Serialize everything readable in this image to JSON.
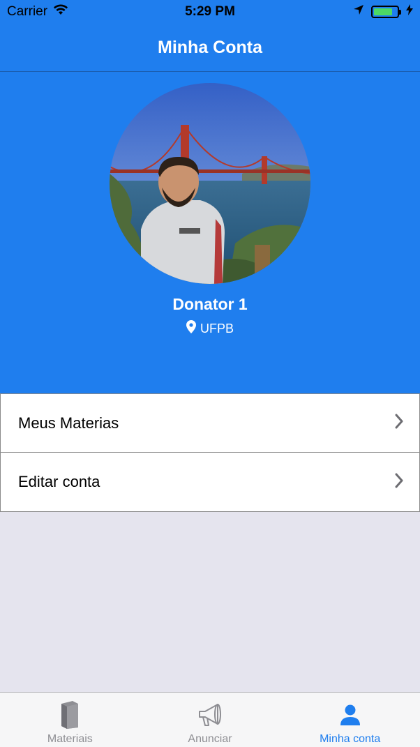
{
  "status_bar": {
    "carrier": "Carrier",
    "time": "5:29 PM"
  },
  "nav": {
    "title": "Minha Conta"
  },
  "profile": {
    "name": "Donator 1",
    "location": "UFPB"
  },
  "menu": {
    "items": [
      {
        "label": "Meus Materias"
      },
      {
        "label": "Editar conta"
      }
    ]
  },
  "tabs": [
    {
      "label": "Materiais",
      "icon": "book-icon",
      "active": false
    },
    {
      "label": "Anunciar",
      "icon": "megaphone-icon",
      "active": false
    },
    {
      "label": "Minha conta",
      "icon": "user-icon",
      "active": true
    }
  ],
  "colors": {
    "accent": "#1f7eee",
    "background": "#e5e4ee",
    "inactive_tab": "#8e8e93",
    "battery": "#4cd964"
  }
}
